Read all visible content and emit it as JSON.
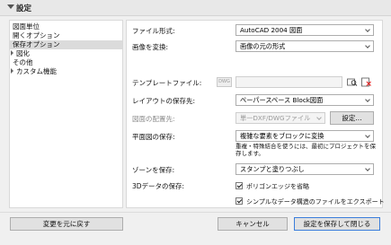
{
  "header": {
    "title": "設定"
  },
  "sidebar": {
    "items": [
      {
        "label": "図面単位",
        "expandable": false,
        "selected": false
      },
      {
        "label": "開くオプション",
        "expandable": false,
        "selected": false
      },
      {
        "label": "保存オプション",
        "expandable": false,
        "selected": true
      },
      {
        "label": "図化",
        "expandable": true,
        "selected": false
      },
      {
        "label": "その他",
        "expandable": false,
        "selected": false
      },
      {
        "label": "カスタム機能",
        "expandable": true,
        "selected": false
      }
    ]
  },
  "form": {
    "file_format": {
      "label": "ファイル形式:",
      "value": "AutoCAD 2004 図面"
    },
    "convert_image": {
      "label": "画像を変換:",
      "value": "画像の元の形式"
    },
    "template": {
      "label": "テンプレートファイル:"
    },
    "layout_save_to": {
      "label": "レイアウトの保存先:",
      "value": "ペーパースペース Block図面"
    },
    "drawing_placement": {
      "label": "図面の配置先:",
      "value": "単一DXF/DWGファイル",
      "button": "設定..."
    },
    "floor_plan_save": {
      "label": "平面図の保存:",
      "value": "複雑な要素をブロックに変換"
    },
    "note": "重複・特殊結合を使うには、最初にプロジェクトを保存します。",
    "zone_save": {
      "label": "ゾーンを保存:",
      "value": "スタンプと塗りつぶし"
    },
    "data_3d": {
      "label": "3Dデータの保存:",
      "options": [
        {
          "label": "ポリゴンエッジを省略",
          "checked": true
        },
        {
          "label": "シンプルなデータ構造のファイルをエクスポート",
          "checked": true
        }
      ]
    }
  },
  "footer": {
    "reset_button": "変更を元に戻す",
    "cancel_button": "キャンセル",
    "save_button": "設定を保存して閉じる"
  },
  "colors": {
    "primary_border": "#3a7ddb",
    "selected_row": "#dbdbdb"
  }
}
